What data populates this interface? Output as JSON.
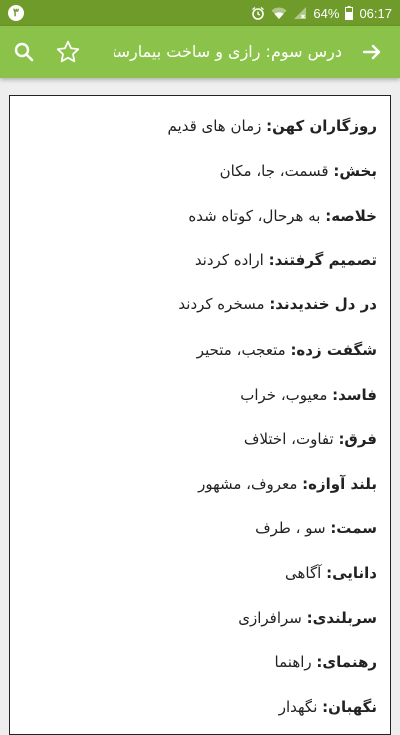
{
  "status_bar": {
    "notification_badge": "۳",
    "battery_percent": "64%",
    "time": "06:17"
  },
  "app_bar": {
    "title": "درس سوم: رازی و ساخت بیمارستان"
  },
  "glossary": [
    {
      "term": "روزگاران کهن:",
      "definition": " زمان های قدیم"
    },
    {
      "term": "بخش:",
      "definition": " قسمت، جا، مکان"
    },
    {
      "term": "خلاصه:",
      "definition": " به هرحال، کوتاه شده"
    },
    {
      "term": "تصمیم گرفتند:",
      "definition": " اراده کردند"
    },
    {
      "term": "در دل خندیدند:",
      "definition": " مسخره کردند"
    },
    {
      "term": "شگفت زده:",
      "definition": " متعجب، متحیر"
    },
    {
      "term": "فاسد:",
      "definition": " معیوب، خراب"
    },
    {
      "term": "فرق:",
      "definition": " تفاوت، اختلاف"
    },
    {
      "term": "بلند آوازه:",
      "definition": " معروف، مشهور"
    },
    {
      "term": "سمت:",
      "definition": " سو ، طرف"
    },
    {
      "term": "دانایی:",
      "definition": " آگاهی"
    },
    {
      "term": "سربلندی:",
      "definition": " سرافرازی"
    },
    {
      "term": "رهنمای:",
      "definition": " راهنما"
    },
    {
      "term": "نگهبان:",
      "definition": " نگهدار"
    }
  ],
  "colors": {
    "status_bar": "#6e9b2a",
    "app_bar": "#8bc34a",
    "background": "#eeeeee"
  }
}
